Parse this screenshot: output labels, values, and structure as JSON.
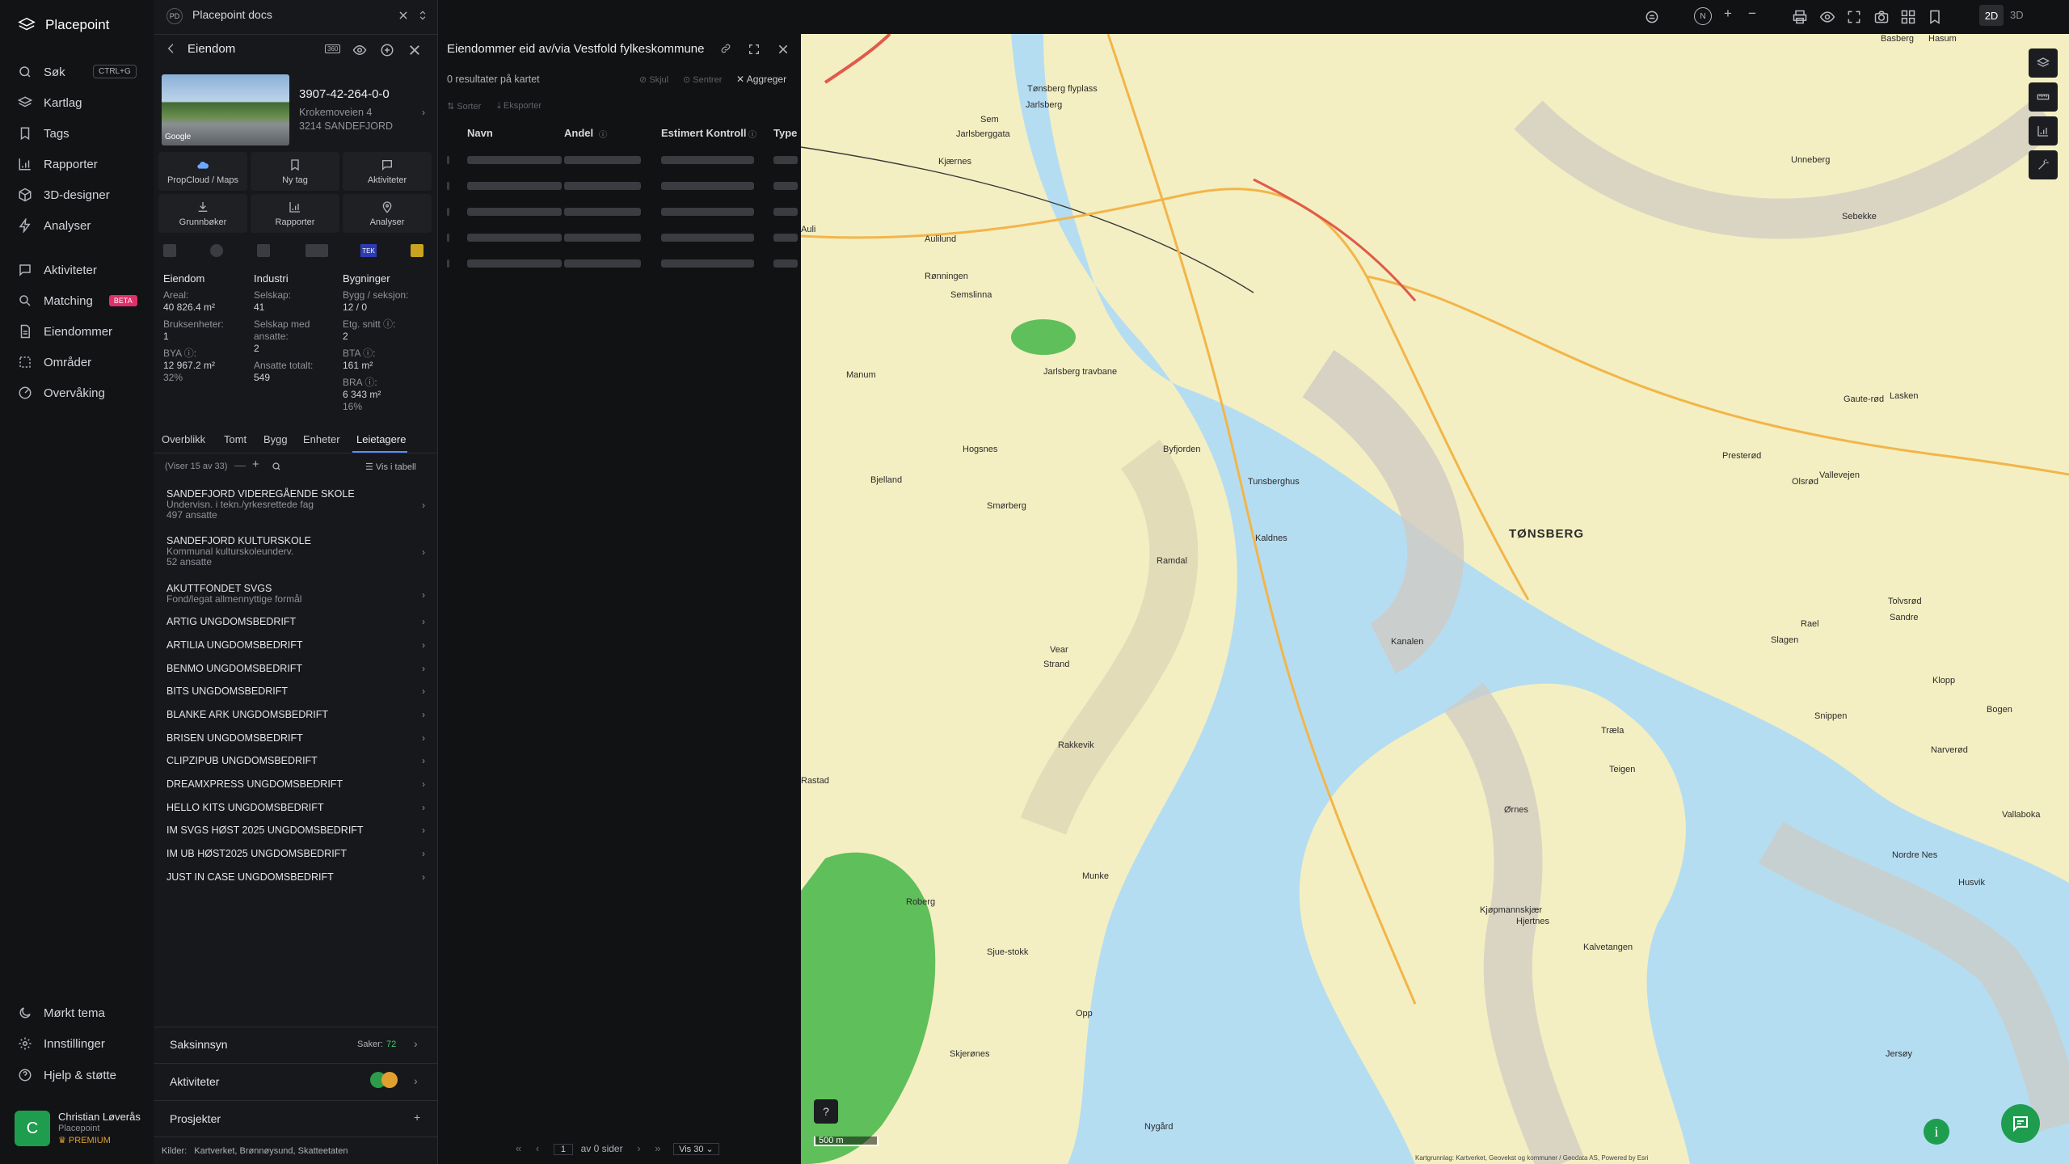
{
  "nav": {
    "brand": "Placepoint",
    "items": [
      {
        "label": "Søk",
        "icon": "search-icon",
        "shortcut": "CTRL+G"
      },
      {
        "label": "Kartlag",
        "icon": "layers-icon"
      },
      {
        "label": "Tags",
        "icon": "bookmark-icon"
      },
      {
        "label": "Rapporter",
        "icon": "chart-icon"
      },
      {
        "label": "3D-designer",
        "icon": "cube-icon"
      },
      {
        "label": "Analyser",
        "icon": "bolt-icon"
      },
      {
        "label": "Aktiviteter",
        "icon": "chat-icon"
      },
      {
        "label": "Matching",
        "icon": "search-list-icon",
        "badge": "BETA"
      },
      {
        "label": "Eiendommer",
        "icon": "document-icon"
      },
      {
        "label": "Områder",
        "icon": "area-icon"
      },
      {
        "label": "Overvåking",
        "icon": "radar-icon"
      }
    ],
    "bottom": [
      {
        "label": "Mørkt tema",
        "icon": "moon-icon"
      },
      {
        "label": "Innstillinger",
        "icon": "gear-icon"
      },
      {
        "label": "Hjelp & støtte",
        "icon": "help-icon"
      }
    ],
    "user": {
      "initial": "C",
      "name": "Christian Løverås",
      "org": "Placepoint",
      "plan": "PREMIUM"
    }
  },
  "workspace": {
    "badge": "PD",
    "avatar": "N",
    "title": "Placepoint docs"
  },
  "property": {
    "header": "Eiendom",
    "id": "3907-42-264-0-0",
    "address1": "Krokemoveien 4",
    "address2": "3214 SANDEFJORD",
    "photo_credit": "Google",
    "actions": [
      {
        "label": "PropCloud / Maps",
        "icon": "propcloud-icon"
      },
      {
        "label": "Ny tag",
        "icon": "tag-icon"
      },
      {
        "label": "Aktiviteter",
        "icon": "chat-icon"
      },
      {
        "label": "Grunnbøker",
        "icon": "download-icon"
      },
      {
        "label": "Rapporter",
        "icon": "chart-icon"
      },
      {
        "label": "Analyser",
        "icon": "pin-icon"
      }
    ],
    "source_badge": "TEK",
    "stats": {
      "eiendom": {
        "title": "Eiendom",
        "areal_label": "Areal:",
        "areal": "40 826.4 m²",
        "bruks_label": "Bruksenheter:",
        "bruks": "1",
        "bya_label": "BYA ⓘ:",
        "bya": "12 967.2 m²",
        "bya_pct": "32%"
      },
      "industri": {
        "title": "Industri",
        "selskap_label": "Selskap:",
        "selskap": "41",
        "ansatte_label": "Selskap med ansatte:",
        "ansatte": "2",
        "totalt_label": "Ansatte totalt:",
        "totalt": "549"
      },
      "bygninger": {
        "title": "Bygninger",
        "bygg_label": "Bygg / seksjon:",
        "bygg": "12 / 0",
        "etg_label": "Etg. snitt ⓘ:",
        "etg": "2",
        "bta_label": "BTA ⓘ:",
        "bta": "161 m²",
        "bra_label": "BRA ⓘ:",
        "bra": "6 343 m²",
        "bra_pct": "16%"
      }
    },
    "tabs": [
      "Overblikk",
      "Tomt",
      "Bygg",
      "Enheter",
      "Leietagere"
    ],
    "active_tab": "Leietagere",
    "list_count": "(Viser 15 av 33)",
    "table_toggle": "Vis i tabell",
    "tenants": [
      {
        "name": "SANDEFJORD VIDEREGÅENDE SKOLE",
        "sub": "Undervisn. i tekn./yrkesrettede fag",
        "emp": "497 ansatte"
      },
      {
        "name": "SANDEFJORD KULTURSKOLE",
        "sub": "Kommunal kulturskoleunderv.",
        "emp": "52 ansatte"
      },
      {
        "name": "AKUTTFONDET SVGS",
        "sub": "Fond/legat allmennyttige formål",
        "emp": ""
      },
      {
        "name": "ARTIG UNGDOMSBEDRIFT"
      },
      {
        "name": "ARTILIA UNGDOMSBEDRIFT"
      },
      {
        "name": "BENMO UNGDOMSBEDRIFT"
      },
      {
        "name": "BITS UNGDOMSBEDRIFT"
      },
      {
        "name": "BLANKE ARK UNGDOMSBEDRIFT"
      },
      {
        "name": "BRISEN UNGDOMSBEDRIFT"
      },
      {
        "name": "CLIPZIPUB UNGDOMSBEDRIFT"
      },
      {
        "name": "DREAMXPRESS UNGDOMSBEDRIFT"
      },
      {
        "name": "HELLO KITS UNGDOMSBEDRIFT"
      },
      {
        "name": "IM SVGS HØST 2025 UNGDOMSBEDRIFT"
      },
      {
        "name": "IM UB HØST2025 UNGDOMSBEDRIFT"
      },
      {
        "name": "JUST IN CASE UNGDOMSBEDRIFT"
      }
    ],
    "saksinnsyn": "Saksinnsyn",
    "saker_label": "Saker:",
    "saker": "72",
    "aktiviteter": "Aktiviteter",
    "prosjekter": "Prosjekter",
    "sources_label": "Kilder:",
    "sources": [
      "Kartverket",
      "Brønnøysund",
      "Skatteetaten"
    ]
  },
  "results": {
    "title": "Eiendommer eid av/via Vestfold fylkeskommune",
    "count": "0 resultater på kartet",
    "hide": "Skjul",
    "center": "Sentrer",
    "aggregate": "Aggreger",
    "sort": "Sorter",
    "export": "Eksporter",
    "columns": [
      "Navn",
      "Andel",
      "Estimert Kontroll",
      "Type"
    ],
    "pagination": {
      "page": "1",
      "of": "av 0 sider",
      "per_page": "Vis 30"
    }
  },
  "map": {
    "mode_2d": "2D",
    "mode_3d": "3D",
    "compass": "N",
    "scale": "500 m",
    "attribution": "Kartgrunnlag: Kartverket, Geovekst og kommuner / Geodata AS, Powered by Esri",
    "places": [
      {
        "t": "TØNSBERG",
        "big": true
      },
      {
        "t": "Tønsberg flyplass"
      },
      {
        "t": "Jarlsberg"
      },
      {
        "t": "Jarlsberggata"
      },
      {
        "t": "Sem"
      },
      {
        "t": "Kjærnes"
      },
      {
        "t": "Auli"
      },
      {
        "t": "Aulilund"
      },
      {
        "t": "Rønningen"
      },
      {
        "t": "Semslinna"
      },
      {
        "t": "Manum"
      },
      {
        "t": "Jarlsberg travbane"
      },
      {
        "t": "Byfjorden"
      },
      {
        "t": "Hogsnes"
      },
      {
        "t": "Bjelland"
      },
      {
        "t": "Smørberg"
      },
      {
        "t": "Tunsberghus"
      },
      {
        "t": "Kaldnes"
      },
      {
        "t": "Ramdal"
      },
      {
        "t": "Vear"
      },
      {
        "t": "Strand"
      },
      {
        "t": "Rakkevik"
      },
      {
        "t": "Rastad"
      },
      {
        "t": "Roberg"
      },
      {
        "t": "Munke"
      },
      {
        "t": "Sjue-stokk"
      },
      {
        "t": "Opp"
      },
      {
        "t": "Nygård"
      },
      {
        "t": "Skjerønes"
      },
      {
        "t": "Husvik"
      },
      {
        "t": "Nordre Nes"
      },
      {
        "t": "Kjøpmannskjær"
      },
      {
        "t": "Snippen"
      },
      {
        "t": "Bogen"
      },
      {
        "t": "Teigen"
      },
      {
        "t": "Ørnes"
      },
      {
        "t": "Hjertnes"
      },
      {
        "t": "Kalvetangen"
      },
      {
        "t": "Jersøy"
      },
      {
        "t": "Hasum"
      },
      {
        "t": "Basberg"
      },
      {
        "t": "Unneberg"
      },
      {
        "t": "Sebekke"
      },
      {
        "t": "Presterød"
      },
      {
        "t": "Olsrød"
      },
      {
        "t": "Gaute-rød"
      },
      {
        "t": "Lasken"
      },
      {
        "t": "Vallevejen"
      },
      {
        "t": "Tolvsrød"
      },
      {
        "t": "Slagen"
      },
      {
        "t": "Rael"
      },
      {
        "t": "Sandre"
      },
      {
        "t": "Klopp"
      },
      {
        "t": "Narverød"
      },
      {
        "t": "Vallaboka"
      },
      {
        "t": "Træla"
      },
      {
        "t": "Kanalen"
      }
    ]
  }
}
